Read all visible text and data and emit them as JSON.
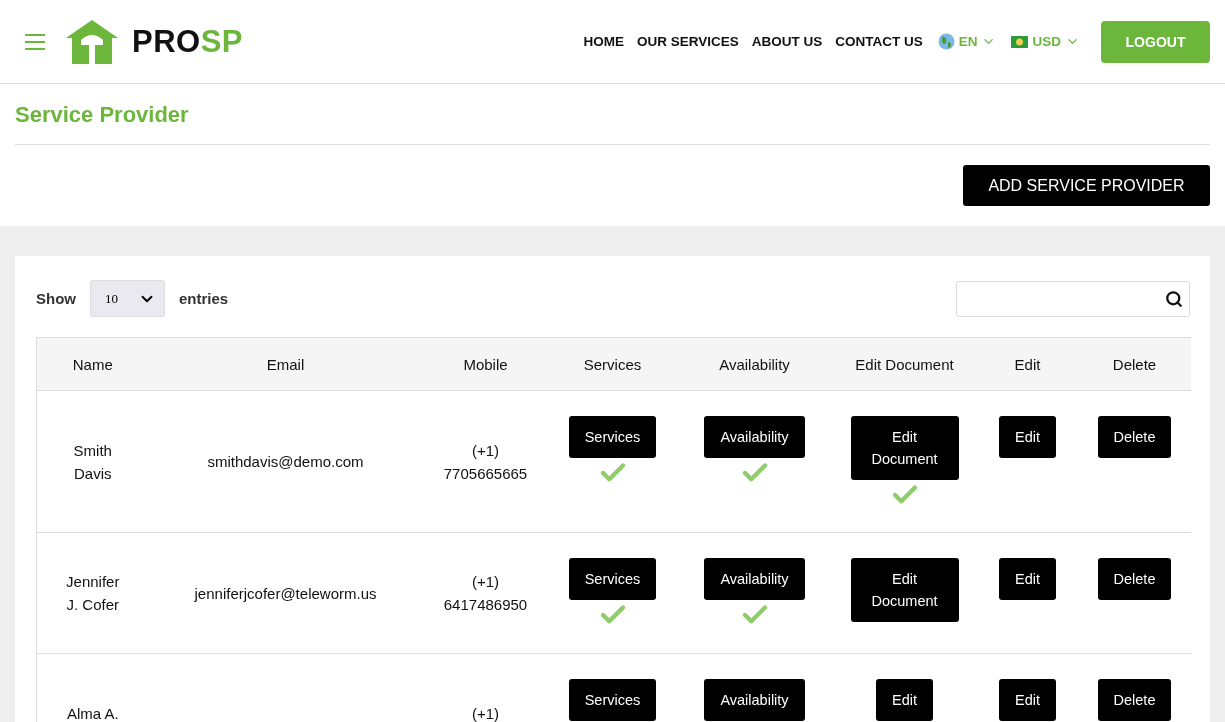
{
  "header": {
    "logo": {
      "dark": "PRO",
      "accent": "SP"
    },
    "nav": [
      "HOME",
      "OUR SERVICES",
      "ABOUT US",
      "CONTACT US"
    ],
    "language": "EN",
    "currency": "USD",
    "logout": "LOGOUT"
  },
  "page": {
    "title": "Service Provider",
    "add_button": "ADD SERVICE PROVIDER"
  },
  "table_controls": {
    "show_label": "Show",
    "page_size": "10",
    "entries_label": "entries"
  },
  "table": {
    "columns": [
      "Name",
      "Email",
      "Mobile",
      "Services",
      "Availability",
      "Edit Document",
      "Edit",
      "Delete"
    ],
    "rows": [
      {
        "name": "Smith Davis",
        "email": "smithdavis@demo.com",
        "mobile": [
          "(+1)",
          "7705665665"
        ],
        "services": "Services",
        "services_verified": true,
        "availability": "Availability",
        "availability_verified": true,
        "document": "Edit Document",
        "document_verified": true,
        "edit": "Edit",
        "delete": "Delete"
      },
      {
        "name": "Jennifer J. Cofer",
        "email": "jenniferjcofer@teleworm.us",
        "mobile": [
          "(+1)",
          "6417486950"
        ],
        "services": "Services",
        "services_verified": true,
        "availability": "Availability",
        "availability_verified": true,
        "document": "Edit Document",
        "document_verified": false,
        "edit": "Edit",
        "delete": "Delete"
      },
      {
        "name": "Alma A.",
        "mobile": [
          "(+1)"
        ],
        "services": "Services",
        "availability": "Availability",
        "document": "Edit",
        "edit": "Edit",
        "delete": "Delete"
      }
    ]
  }
}
